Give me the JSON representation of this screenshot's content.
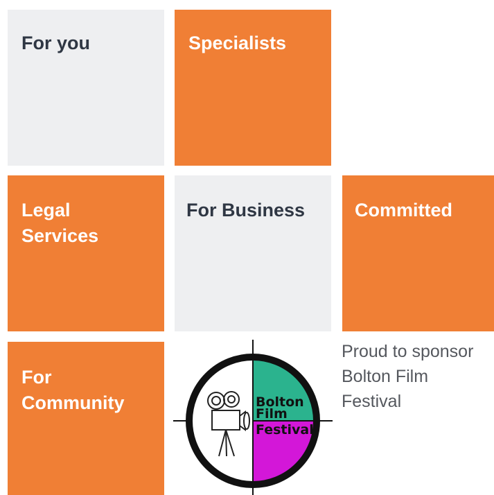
{
  "tiles": {
    "for_you": "For you",
    "specialists": "Specialists",
    "legal_services": "Legal\nServices",
    "for_business": "For Business",
    "committed": "Committed",
    "for_community": "For\nCommunity"
  },
  "sponsor": {
    "line1": "Proud to sponsor",
    "line2": "Bolton Film",
    "line3": "Festival"
  },
  "logo": {
    "line1": "Bolton",
    "line2": "Film",
    "line3": "Festival",
    "colors": {
      "top_quadrant": "#2bb38e",
      "bottom_quadrant": "#d317d8",
      "ring": "#111111"
    }
  },
  "colors": {
    "orange": "#f07f35",
    "grey": "#eeeff1",
    "dark_text": "#2f3744"
  }
}
